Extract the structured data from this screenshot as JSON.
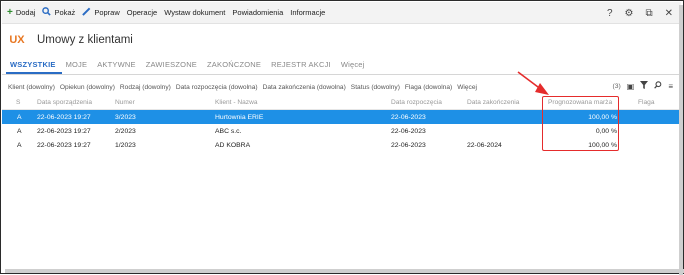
{
  "toolbar": {
    "add_label": "Dodaj",
    "show_label": "Pokaż",
    "edit_label": "Popraw",
    "ops_label": "Operacje",
    "issue_doc_label": "Wystaw dokument",
    "notify_label": "Powiadomienia",
    "info_label": "Informacje",
    "help_glyph": "?"
  },
  "header": {
    "logo": "UX",
    "title": "Umowy z klientami"
  },
  "tabs": [
    "WSZYSTKIE",
    "MOJE",
    "AKTYWNE",
    "ZAWIESZONE",
    "ZAKOŃCZONE",
    "REJESTR AKCJI",
    "Więcej"
  ],
  "filters": [
    "Klient (dowolny)",
    "Opiekun (dowolny)",
    "Rodzaj (dowolny)",
    "Data rozpoczęcia (dowolna)",
    "Data zakończenia (dowolna)",
    "Status (dowolny)",
    "Flaga (dowolna)",
    "Więcej"
  ],
  "filter_count": "(3)",
  "table": {
    "columns": [
      "S",
      "Data sporządzenia",
      "Numer",
      "Klient - Nazwa",
      "Data rozpoczęcia",
      "Data zakończenia",
      "Prognozowana marża",
      "Flaga"
    ],
    "rows": [
      {
        "s": "A",
        "date": "22-06-2023 19:27",
        "num": "3/2023",
        "client": "Hurtownia ERIE",
        "start": "22-06-2023",
        "end": "",
        "margin": "100,00 %",
        "flag": ""
      },
      {
        "s": "A",
        "date": "22-06-2023 19:27",
        "num": "2/2023",
        "client": "ABC s.c.",
        "start": "22-06-2023",
        "end": "",
        "margin": "0,00 %",
        "flag": ""
      },
      {
        "s": "A",
        "date": "22-06-2023 19:27",
        "num": "1/2023",
        "client": "AD KOBRA",
        "start": "22-06-2023",
        "end": "22-06-2024",
        "margin": "100,00 %",
        "flag": ""
      }
    ]
  },
  "colors": {
    "accent": "#2a6cc4",
    "selected_row": "#1e90e6",
    "logo": "#e87722",
    "annotation": "#e52c2c"
  }
}
